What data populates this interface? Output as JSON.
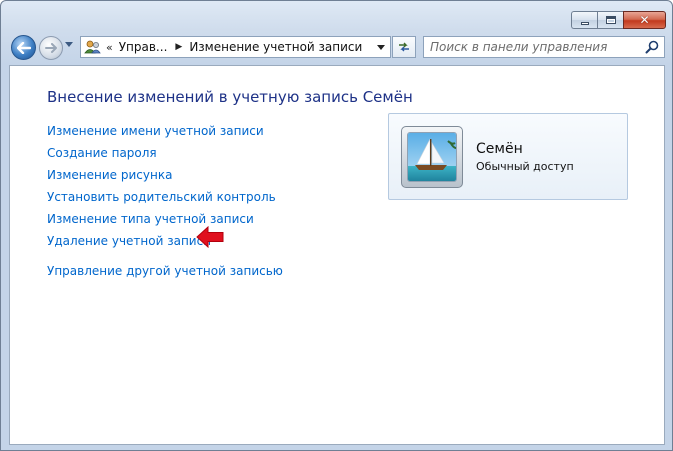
{
  "window": {
    "controls": {
      "minimize_icon": "minimize-icon",
      "maximize_icon": "maximize-icon",
      "close_icon": "close-icon"
    }
  },
  "navigation": {
    "back_icon": "back-arrow-icon",
    "forward_icon": "forward-arrow-icon",
    "address": {
      "icon": "user-accounts-icon",
      "overflow": "«",
      "segments": [
        "Управ...",
        "Изменение учетной записи"
      ]
    },
    "refresh_icon": "refresh-icon",
    "search": {
      "placeholder": "Поиск в панели управления",
      "icon": "search-icon"
    }
  },
  "content": {
    "title": "Внесение изменений в учетную запись Семён",
    "links": [
      "Изменение имени учетной записи",
      "Создание пароля",
      "Изменение рисунка",
      "Установить родительский контроль",
      "Изменение типа учетной записи",
      "Удаление учетной записи"
    ],
    "other_link": "Управление другой учетной записью",
    "highlight": {
      "target": "Удаление учетной записи",
      "color": "#e0101e"
    },
    "account": {
      "name": "Семён",
      "type": "Обычный доступ",
      "picture": "sailboat-picture"
    }
  },
  "colors": {
    "link": "#0066cc",
    "title": "#1e3287"
  }
}
